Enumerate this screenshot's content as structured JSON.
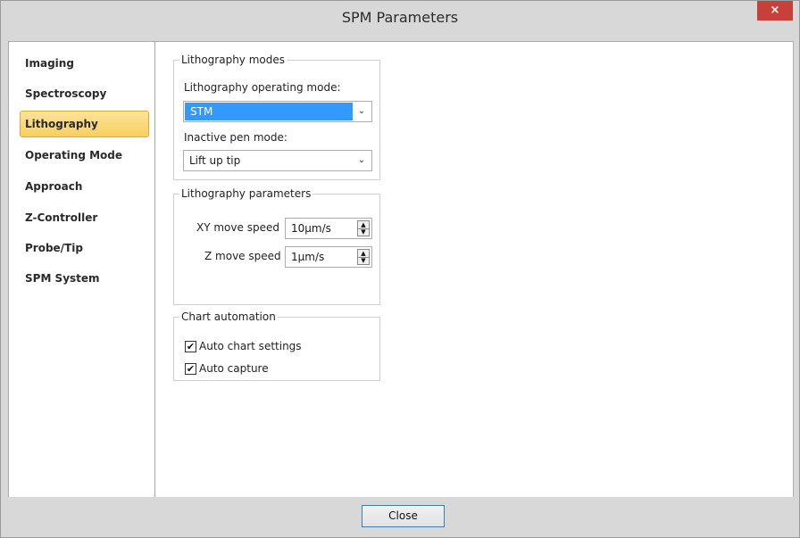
{
  "window": {
    "title": "SPM Parameters",
    "close_glyph": "×"
  },
  "sidebar": {
    "items": [
      {
        "label": "Imaging"
      },
      {
        "label": "Spectroscopy"
      },
      {
        "label": "Lithography",
        "active": true
      },
      {
        "label": "Operating Mode"
      },
      {
        "label": "Approach"
      },
      {
        "label": "Z-Controller"
      },
      {
        "label": "Probe/Tip"
      },
      {
        "label": "SPM System"
      }
    ]
  },
  "lithography_modes": {
    "legend": "Lithography modes",
    "operating_mode_label": "Lithography operating mode:",
    "operating_mode_value": "STM",
    "inactive_pen_label": "Inactive pen mode:",
    "inactive_pen_value": "Lift up tip"
  },
  "lithography_parameters": {
    "legend": "Lithography parameters",
    "xy_label": "XY move speed",
    "xy_value": "10µm/s",
    "z_label": "Z move speed",
    "z_value": "1µm/s"
  },
  "chart_automation": {
    "legend": "Chart automation",
    "auto_chart_label": "Auto chart settings",
    "auto_chart_checked": true,
    "auto_capture_label": "Auto capture",
    "auto_capture_checked": true,
    "check_glyph": "✔"
  },
  "footer": {
    "close_label": "Close"
  },
  "icons": {
    "dropdown": "chevron-down-icon",
    "spin_up": "spin-up-icon",
    "spin_down": "spin-down-icon"
  },
  "colors": {
    "selection": "#3399ff",
    "active_nav": "#f8cf5f",
    "close_button": "#c7403a"
  }
}
